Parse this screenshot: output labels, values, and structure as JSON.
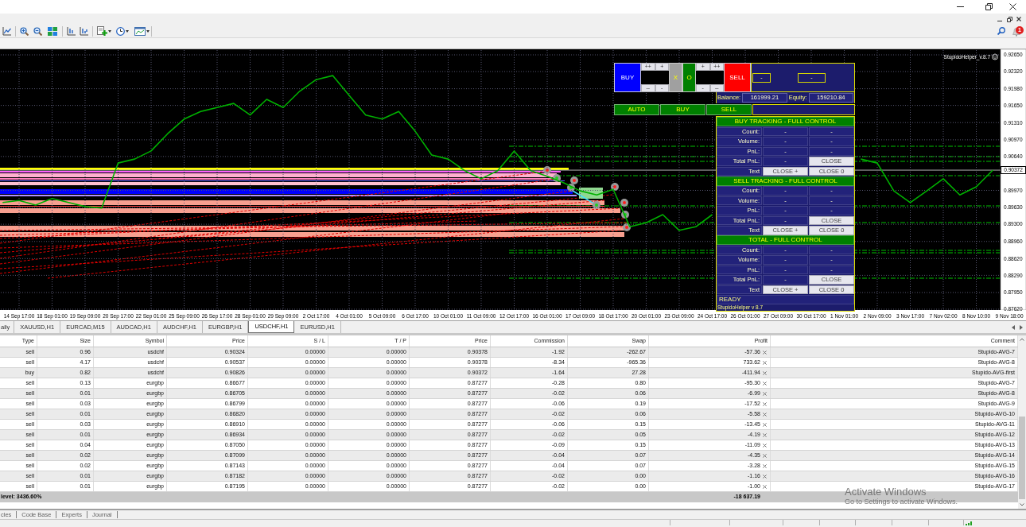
{
  "toolbar": {
    "notification_count": "1"
  },
  "chart_window": {
    "indicator_label": "StupidoHelper_v.8.7",
    "current_price_label": "0.90372",
    "chart_data": {
      "type": "line",
      "grid": true,
      "ylim": [
        0.8762,
        0.9265
      ],
      "categories": [
        null,
        "14 Sep 17:00",
        null,
        "18 Sep 01:00",
        null,
        "19 Sep 09:00",
        null,
        "20 Sep 17:00",
        null,
        "22 Sep 01:00",
        null,
        "25 Sep 09:00",
        null,
        "26 Sep 17:00",
        null,
        "28 Sep 01:00",
        null,
        "29 Sep 09:00",
        null,
        "2 Oct 17:00",
        null,
        "4 Oct 01:00",
        null,
        "5 Oct 09:00",
        null,
        "6 Oct 17:00",
        null,
        "10 Oct 01:00",
        null,
        "11 Oct 09:00",
        null,
        "12 Oct 17:00",
        null,
        "16 Oct 01:00",
        null,
        "17 Oct 09:00",
        null,
        "18 Oct 17:00",
        null,
        "20 Oct 01:00",
        null,
        "23 Oct 09:00",
        null,
        "24 Oct 17:00",
        null,
        "26 Oct 01:00",
        null,
        "27 Oct 09:00",
        null,
        "30 Oct 17:00",
        null,
        "1 Nov 01:00",
        null,
        "2 Nov 09:00",
        null,
        "3 Nov 17:00",
        null,
        "7 Nov 02:00",
        null,
        "8 Nov 10:00",
        null,
        "9 Nov 18:00"
      ],
      "yticks": [
        {
          "value": 0.9265,
          "label": "0.92650"
        },
        {
          "value": 0.9232,
          "label": "0.92320"
        },
        {
          "value": 0.9198,
          "label": "0.91980"
        },
        {
          "value": 0.9165,
          "label": "0.91650"
        },
        {
          "value": 0.9131,
          "label": "0.91310"
        },
        {
          "value": 0.9097,
          "label": "0.90970"
        },
        {
          "value": 0.9064,
          "label": "0.90640"
        },
        {
          "value": 0.8997,
          "label": "0.89970"
        },
        {
          "value": 0.8963,
          "label": "0.89630"
        },
        {
          "value": 0.893,
          "label": "0.89300"
        },
        {
          "value": 0.8896,
          "label": "0.88960"
        },
        {
          "value": 0.8862,
          "label": "0.88620"
        },
        {
          "value": 0.8829,
          "label": "0.88290"
        },
        {
          "value": 0.8795,
          "label": "0.87950"
        },
        {
          "value": 0.8762,
          "label": "0.87620"
        }
      ],
      "series": [
        {
          "color": "#00b000",
          "values": [
            0.8973,
            0.8977,
            0.8968,
            0.8981,
            0.8973,
            0.8965,
            0.8962,
            0.9051,
            0.9059,
            0.9075,
            0.9109,
            0.9138,
            0.9153,
            0.9161,
            0.9169,
            0.9146,
            0.9177,
            0.9161,
            0.9193,
            0.9216,
            0.9224,
            0.9185,
            0.9146,
            0.9138,
            0.9153,
            0.9114,
            0.9067,
            0.9059,
            0.9036,
            0.902,
            0.9036,
            0.9075,
            0.9036,
            0.9025,
            0.9012,
            0.8996,
            0.8988,
            0.8999,
            0.8925,
            0.8933,
            0.8949,
            0.8918,
            0.8925,
            0.8949,
            null,
            null,
            null,
            null,
            null,
            null,
            null,
            null,
            0.9059,
            0.9051,
            0.8996,
            0.8973,
            0.8996,
            0.902,
            0.8988,
            0.9004,
            0.9037,
            null
          ]
        }
      ]
    },
    "trade_panel": {
      "top_controls": [
        {
          "kind": "trade",
          "label": "BUY",
          "color": "#0000ff"
        },
        {
          "kind": "stepper",
          "top": [
            "++",
            "+"
          ],
          "bottom": [
            "--",
            "-"
          ]
        },
        {
          "kind": "toggle",
          "label": "X",
          "color": "#a0a0a0"
        },
        {
          "kind": "toggle",
          "label": "O",
          "color": "#008000"
        },
        {
          "kind": "stepper",
          "top": [
            "+",
            "++"
          ],
          "bottom": [
            "-",
            "--"
          ]
        },
        {
          "kind": "trade",
          "label": "SELL",
          "color": "#ff0000"
        }
      ],
      "fields": [
        {
          "value": "-"
        },
        {
          "value": "-"
        }
      ],
      "account": [
        {
          "label": "Balance:",
          "value": "161999.21"
        },
        {
          "label": "Equity:",
          "value": "159210.84"
        }
      ],
      "mode_buttons": [
        {
          "label": "AUTO"
        },
        {
          "label": "BUY"
        },
        {
          "label": "SELL"
        }
      ],
      "sections": [
        {
          "title": "BUY TRACKING - FULL CONTROL",
          "rows": [
            {
              "label": "Count:",
              "cells": [
                {
                  "kind": "value",
                  "text": "-"
                },
                {
                  "kind": "value",
                  "text": "-"
                }
              ]
            },
            {
              "label": "Volume:",
              "cells": [
                {
                  "kind": "value",
                  "text": "-"
                },
                {
                  "kind": "value",
                  "text": "-"
                }
              ]
            },
            {
              "label": "PnL:",
              "cells": [
                {
                  "kind": "value",
                  "text": "-"
                },
                {
                  "kind": "value",
                  "text": "-"
                }
              ]
            },
            {
              "label": "Total PnL:",
              "cells": [
                {
                  "kind": "value",
                  "text": "-"
                },
                {
                  "kind": "button",
                  "text": "CLOSE"
                }
              ]
            },
            {
              "label": "Text",
              "cells": [
                {
                  "kind": "button",
                  "text": "CLOSE +"
                },
                {
                  "kind": "button",
                  "text": "CLOSE 0"
                }
              ]
            }
          ]
        },
        {
          "title": "SELL TRACKING - FULL CONTROL",
          "rows": [
            {
              "label": "Count:",
              "cells": [
                {
                  "kind": "value",
                  "text": "-"
                },
                {
                  "kind": "value",
                  "text": "-"
                }
              ]
            },
            {
              "label": "Volume:",
              "cells": [
                {
                  "kind": "value",
                  "text": "-"
                },
                {
                  "kind": "value",
                  "text": "-"
                }
              ]
            },
            {
              "label": "PnL:",
              "cells": [
                {
                  "kind": "value",
                  "text": "-"
                },
                {
                  "kind": "value",
                  "text": "-"
                }
              ]
            },
            {
              "label": "Total PnL:",
              "cells": [
                {
                  "kind": "value",
                  "text": "-"
                },
                {
                  "kind": "button",
                  "text": "CLOSE"
                }
              ]
            },
            {
              "label": "Text",
              "cells": [
                {
                  "kind": "button",
                  "text": "CLOSE +"
                },
                {
                  "kind": "button",
                  "text": "CLOSE 0"
                }
              ]
            }
          ]
        },
        {
          "title": "TOTAL - FULL CONTROL",
          "rows": [
            {
              "label": "Count:",
              "cells": [
                {
                  "kind": "value",
                  "text": "-"
                },
                {
                  "kind": "value",
                  "text": "-"
                }
              ]
            },
            {
              "label": "Volume:",
              "cells": [
                {
                  "kind": "value",
                  "text": "-"
                },
                {
                  "kind": "value",
                  "text": "-"
                }
              ]
            },
            {
              "label": "PnL:",
              "cells": [
                {
                  "kind": "value",
                  "text": "-"
                },
                {
                  "kind": "value",
                  "text": "-"
                }
              ]
            },
            {
              "label": "Total PnL:",
              "cells": [
                {
                  "kind": "value",
                  "text": "-"
                },
                {
                  "kind": "button",
                  "text": "CLOSE"
                }
              ]
            },
            {
              "label": "Text",
              "cells": [
                {
                  "kind": "button",
                  "text": "CLOSE +"
                },
                {
                  "kind": "button",
                  "text": "CLOSE 0"
                }
              ]
            }
          ]
        }
      ],
      "status": "READY",
      "footer": "StupidoHelper v 8.7"
    }
  },
  "chart_tabs": [
    {
      "label": "aily",
      "selected": false
    },
    {
      "label": "XAUUSD,H1",
      "selected": false
    },
    {
      "label": "EURCAD,M15",
      "selected": false
    },
    {
      "label": "AUDCAD,H1",
      "selected": false
    },
    {
      "label": "AUDCHF,H1",
      "selected": false
    },
    {
      "label": "EURGBP,H1",
      "selected": false
    },
    {
      "label": "USDCHF,H1",
      "selected": true
    },
    {
      "label": "EURUSD,H1",
      "selected": false
    }
  ],
  "positions_table": {
    "columns": [
      {
        "label": "Type",
        "kind": "text"
      },
      {
        "label": "Size",
        "kind": "text"
      },
      {
        "label": "Symbol",
        "kind": "text"
      },
      {
        "label": "Price",
        "kind": "text"
      },
      {
        "label": "S / L",
        "kind": "text"
      },
      {
        "label": "T / P",
        "kind": "text"
      },
      {
        "label": "Price",
        "kind": "text"
      },
      {
        "label": "Commission",
        "kind": "text"
      },
      {
        "label": "Swap",
        "kind": "text"
      },
      {
        "label": "Profit",
        "kind": "closable"
      },
      {
        "label": "Comment",
        "kind": "text"
      }
    ],
    "rows": [
      [
        "sell",
        "0.96",
        "usdchf",
        "0.90324",
        "0.00000",
        "0.00000",
        "0.90378",
        "-1.92",
        "-262.67",
        "-57.36",
        "Stupido-AVG-7"
      ],
      [
        "sell",
        "4.17",
        "usdchf",
        "0.90537",
        "0.00000",
        "0.00000",
        "0.90378",
        "-8.34",
        "-965.36",
        "733.62",
        "Stupido-AVG-8"
      ],
      [
        "buy",
        "0.82",
        "usdchf",
        "0.90826",
        "0.00000",
        "0.00000",
        "0.90372",
        "-1.64",
        "27.28",
        "-411.94",
        "Stupido-AVG-first"
      ],
      [
        "sell",
        "0.13",
        "eurgbp",
        "0.86677",
        "0.00000",
        "0.00000",
        "0.87277",
        "-0.28",
        "0.80",
        "-95.30",
        "Stupido-AVG-7"
      ],
      [
        "sell",
        "0.01",
        "eurgbp",
        "0.86705",
        "0.00000",
        "0.00000",
        "0.87277",
        "-0.02",
        "0.06",
        "-6.99",
        "Stupido-AVG-8"
      ],
      [
        "sell",
        "0.03",
        "eurgbp",
        "0.86799",
        "0.00000",
        "0.00000",
        "0.87277",
        "-0.06",
        "0.19",
        "-17.52",
        "Stupido-AVG-9"
      ],
      [
        "sell",
        "0.01",
        "eurgbp",
        "0.86820",
        "0.00000",
        "0.00000",
        "0.87277",
        "-0.02",
        "0.06",
        "-5.58",
        "Stupido-AVG-10"
      ],
      [
        "sell",
        "0.03",
        "eurgbp",
        "0.86910",
        "0.00000",
        "0.00000",
        "0.87277",
        "-0.06",
        "0.15",
        "-13.45",
        "Stupido-AVG-11"
      ],
      [
        "sell",
        "0.01",
        "eurgbp",
        "0.86934",
        "0.00000",
        "0.00000",
        "0.87277",
        "-0.02",
        "0.05",
        "-4.19",
        "Stupido-AVG-12"
      ],
      [
        "sell",
        "0.04",
        "eurgbp",
        "0.87050",
        "0.00000",
        "0.00000",
        "0.87277",
        "-0.09",
        "0.15",
        "-11.09",
        "Stupido-AVG-13"
      ],
      [
        "sell",
        "0.02",
        "eurgbp",
        "0.87099",
        "0.00000",
        "0.00000",
        "0.87277",
        "-0.04",
        "0.07",
        "-4.35",
        "Stupido-AVG-14"
      ],
      [
        "sell",
        "0.02",
        "eurgbp",
        "0.87143",
        "0.00000",
        "0.00000",
        "0.87277",
        "-0.04",
        "0.07",
        "-3.28",
        "Stupido-AVG-15"
      ],
      [
        "sell",
        "0.01",
        "eurgbp",
        "0.87182",
        "0.00000",
        "0.00000",
        "0.87277",
        "-0.02",
        "0.00",
        "-1.16",
        "Stupido-AVG-16"
      ],
      [
        "sell",
        "0.01",
        "eurgbp",
        "0.87195",
        "0.00000",
        "0.00000",
        "0.87277",
        "-0.02",
        "0.00",
        "-1.00",
        "Stupido-AVG-17"
      ]
    ]
  },
  "summary": {
    "margin_level": "level: 3436.60%",
    "total_profit": "-18 637.19"
  },
  "terminal_tabs": [
    {
      "label": "cles",
      "selected": false
    },
    {
      "label": "Code Base",
      "selected": false
    },
    {
      "label": "Experts",
      "selected": false
    },
    {
      "label": "Journal",
      "selected": false
    }
  ],
  "activation_notice": {
    "title": "Activate Windows",
    "subtitle": "Go to Settings to activate Windows."
  }
}
